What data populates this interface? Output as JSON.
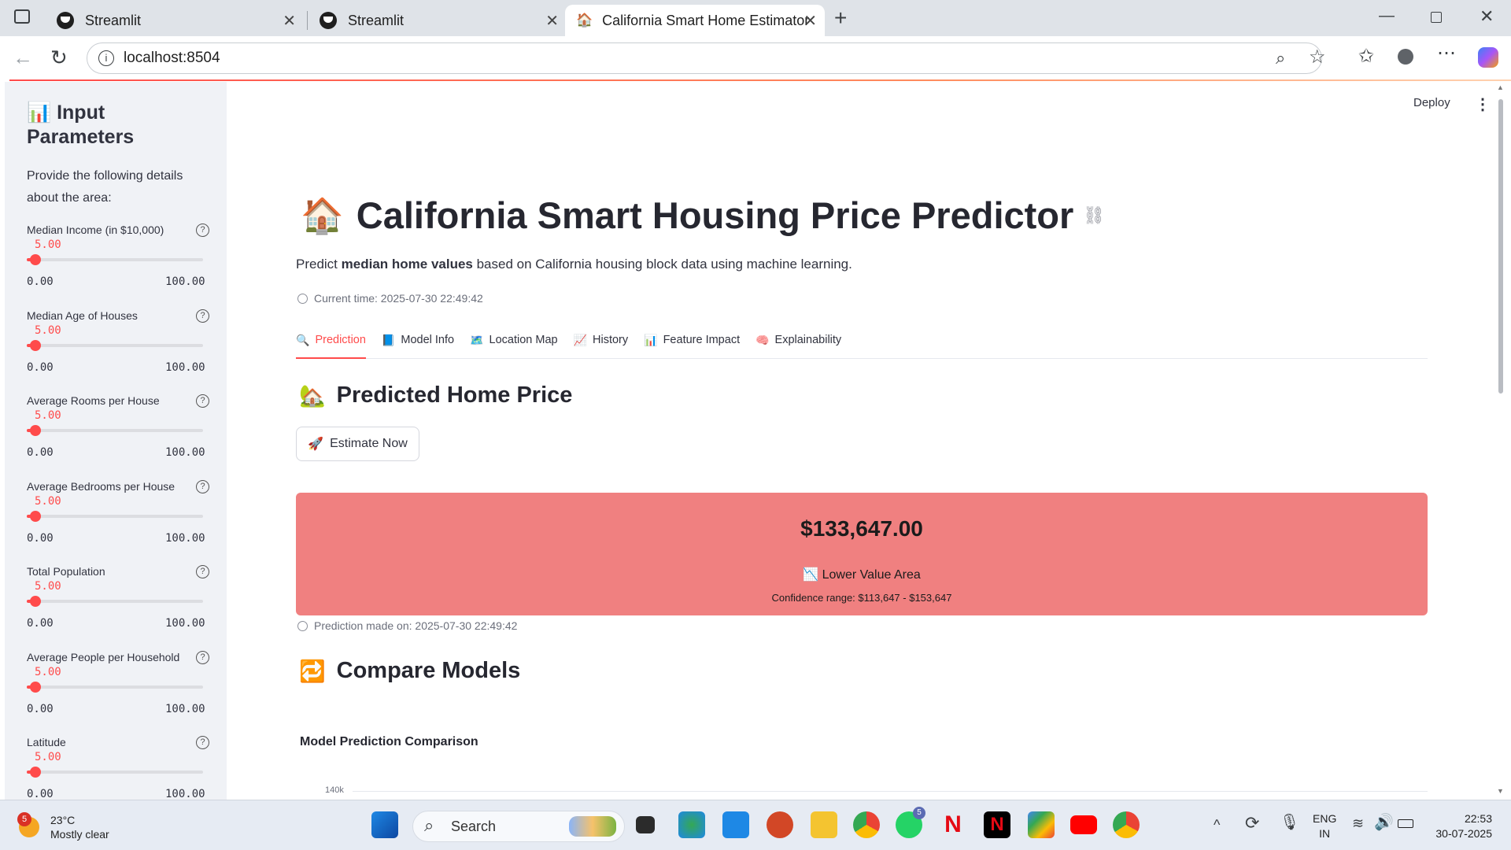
{
  "browser": {
    "tabs": [
      {
        "title": "Streamlit",
        "active": false
      },
      {
        "title": "Streamlit",
        "active": false
      },
      {
        "title": "California Smart Home Estimator",
        "active": true
      }
    ],
    "url": "localhost:8504"
  },
  "sidebar": {
    "title_emoji": "📊",
    "title": "Input Parameters",
    "intro": "Provide the following details about the area:",
    "sliders": [
      {
        "label": "Median Income (in $10,000)",
        "value": "5.00",
        "min": "0.00",
        "max": "100.00",
        "fraction": 0.05
      },
      {
        "label": "Median Age of Houses",
        "value": "5.00",
        "min": "0.00",
        "max": "100.00",
        "fraction": 0.05
      },
      {
        "label": "Average Rooms per House",
        "value": "5.00",
        "min": "0.00",
        "max": "100.00",
        "fraction": 0.05
      },
      {
        "label": "Average Bedrooms per House",
        "value": "5.00",
        "min": "0.00",
        "max": "100.00",
        "fraction": 0.05
      },
      {
        "label": "Total Population",
        "value": "5.00",
        "min": "0.00",
        "max": "100.00",
        "fraction": 0.05
      },
      {
        "label": "Average People per Household",
        "value": "5.00",
        "min": "0.00",
        "max": "100.00",
        "fraction": 0.05
      },
      {
        "label": "Latitude",
        "value": "5.00",
        "min": "0.00",
        "max": "100.00",
        "fraction": 0.05
      }
    ]
  },
  "header": {
    "deploy": "Deploy"
  },
  "main": {
    "title_emoji": "🏠",
    "title": "California Smart Housing Price Predictor",
    "desc_pre": "Predict ",
    "desc_bold": "median home values",
    "desc_post": " based on California housing block data using machine learning.",
    "current_time": "Current time: 2025-07-30 22:49:42",
    "tabs": [
      {
        "icon": "🔍",
        "label": "Prediction",
        "active": true
      },
      {
        "icon": "📘",
        "label": "Model Info"
      },
      {
        "icon": "🗺️",
        "label": "Location Map"
      },
      {
        "icon": "📈",
        "label": "History"
      },
      {
        "icon": "📊",
        "label": "Feature Impact"
      },
      {
        "icon": "🧠",
        "label": "Explainability"
      }
    ],
    "predicted_header_emoji": "🏡",
    "predicted_header": "Predicted Home Price",
    "estimate_button_emoji": "🚀",
    "estimate_button": "Estimate Now",
    "result": {
      "price": "$133,647.00",
      "area_emoji": "📉",
      "area_label": "Lower Value Area",
      "confidence": "Confidence range: $113,647 - $153,647",
      "color": "#f08080"
    },
    "prediction_time": "Prediction made on: 2025-07-30 22:49:42",
    "compare_header_emoji": "🔁",
    "compare_header": "Compare Models",
    "chart_title": "Model Prediction Comparison",
    "chart_tick": "140k"
  },
  "taskbar": {
    "weather_badge": "5",
    "temperature": "23°C",
    "weather": "Mostly clear",
    "search": "Search",
    "whatsapp_badge": "5",
    "lang_line1": "ENG",
    "lang_line2": "IN",
    "time": "22:53",
    "date": "30-07-2025"
  },
  "colors": {
    "accent": "#ff4b4b",
    "sidebar_bg": "#f0f2f6",
    "result_bg": "#f08080"
  }
}
